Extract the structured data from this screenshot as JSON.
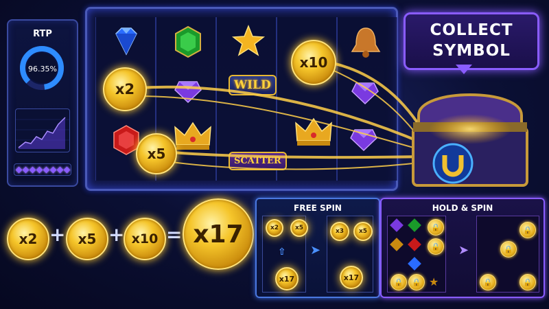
{
  "rtp": {
    "label": "RTP",
    "value": "96.35%"
  },
  "reels": {
    "wild_label": "WILD",
    "scatter_label": "SCATTER",
    "coins": {
      "c1": "x2",
      "c2": "x5",
      "c3": "x10"
    },
    "symbols": {
      "blue_gem": "blue-diamond-icon",
      "green_gem": "green-emerald-icon",
      "star": "gold-star-icon",
      "bell": "bell-icon",
      "purple_gem": "purple-gem-icon",
      "red_gem": "red-gem-icon",
      "crown": "crown-icon"
    }
  },
  "collect": {
    "line1": "COLLECT",
    "line2": "SYMBOL"
  },
  "formula": {
    "a": "x2",
    "b": "x5",
    "c": "x10",
    "plus": "+",
    "equals": "=",
    "result": "x17"
  },
  "free_spin": {
    "title": "FREE SPIN",
    "left": {
      "c1": "x2",
      "c2": "x5",
      "c3": "x17"
    },
    "right": {
      "c1": "x3",
      "c2": "x5",
      "c3": "x17"
    }
  },
  "hold_spin": {
    "title": "HOLD & SPIN"
  },
  "colors": {
    "gold": "#f5c52a",
    "purple": "#8a5cff",
    "blue": "#4a78e0"
  }
}
